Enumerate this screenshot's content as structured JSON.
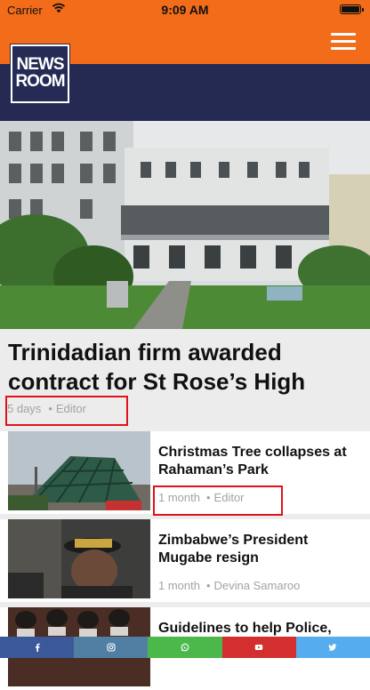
{
  "status_bar": {
    "carrier": "Carrier",
    "time": "9:09 AM"
  },
  "header": {
    "menu_icon": "hamburger-icon",
    "logo_lines": [
      "NEWS",
      "ROOM"
    ]
  },
  "colors": {
    "header_orange": "#f26c1a",
    "brand_navy": "#242a52",
    "highlight_red": "#e0121b",
    "facebook": "#3b5998",
    "instagram": "#517fa4",
    "whatsapp": "#4cb84c",
    "youtube": "#d32f2f",
    "twitter": "#55acee"
  },
  "featured": {
    "title": "Trinidadian firm awarded contract for St Rose’s High",
    "time": "5 days",
    "author": "Editor",
    "separator": "•"
  },
  "articles": [
    {
      "title": "Christmas Tree collapses at Rahaman’s Park",
      "time": "1 month",
      "author": "Editor",
      "separator": "•"
    },
    {
      "title": "Zimbabwe’s President Mugabe resign",
      "time": "1 month",
      "author": "Devina Samaroo",
      "separator": "•"
    },
    {
      "title": "Guidelines to help Police,",
      "time": "",
      "author": "",
      "separator": ""
    }
  ],
  "share_bar": [
    {
      "name": "facebook",
      "icon": "facebook-icon"
    },
    {
      "name": "instagram",
      "icon": "instagram-icon"
    },
    {
      "name": "whatsapp",
      "icon": "whatsapp-icon"
    },
    {
      "name": "youtube",
      "icon": "youtube-icon"
    },
    {
      "name": "twitter",
      "icon": "twitter-icon"
    }
  ]
}
